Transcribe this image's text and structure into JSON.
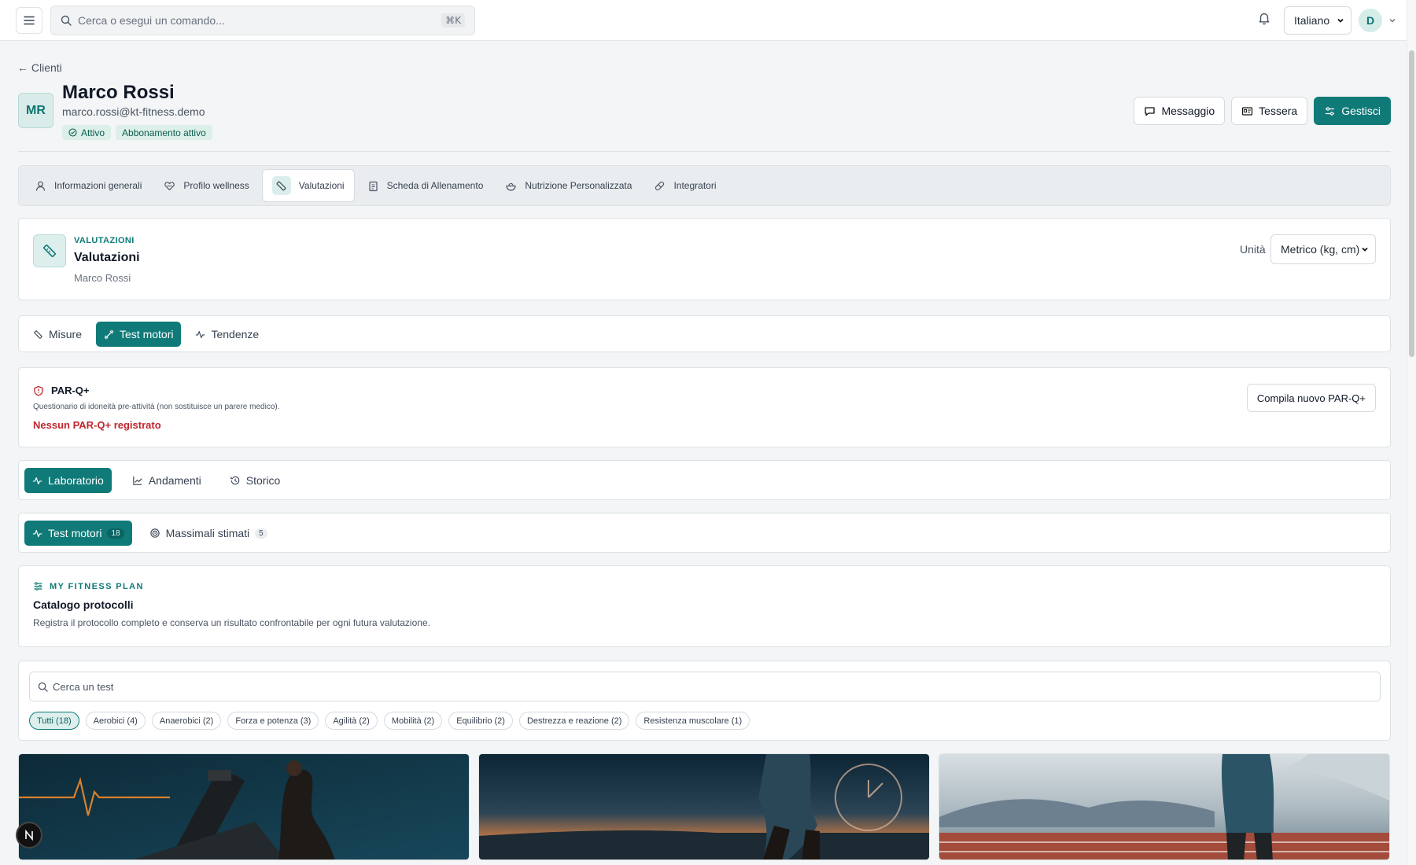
{
  "topbar": {
    "search_placeholder": "Cerca o esegui un comando...",
    "shortcut": "⌘K",
    "language": "Italiano",
    "user_initial": "D"
  },
  "client": {
    "back_label": "← Clienti",
    "initials": "MR",
    "name": "Marco Rossi",
    "email": "marco.rossi@kt-fitness.demo",
    "badges": [
      "Attivo",
      "Abbonamento attivo"
    ]
  },
  "actions": {
    "message": "Messaggio",
    "card": "Tessera",
    "manage": "Gestisci"
  },
  "section_tabs": [
    {
      "label": "Informazioni generali",
      "icon": "user-icon"
    },
    {
      "label": "Profilo wellness",
      "icon": "heart-icon"
    },
    {
      "label": "Valutazioni",
      "icon": "ruler-icon"
    },
    {
      "label": "Scheda di Allenamento",
      "icon": "clipboard-icon"
    },
    {
      "label": "Nutrizione Personalizzata",
      "icon": "salad-icon"
    },
    {
      "label": "Integratori",
      "icon": "pill-icon"
    }
  ],
  "valutazioni": {
    "eyebrow": "VALUTAZIONI",
    "title": "Valutazioni",
    "subtitle": "Marco Rossi",
    "unit_label": "Unità",
    "unit_value": "Metrico (kg, cm)"
  },
  "sub_tabs": [
    "Misure",
    "Test motori",
    "Tendenze"
  ],
  "parq": {
    "title": "PAR-Q+",
    "description": "Questionario di idoneità pre-attività (non sostituisce un parere medico).",
    "status": "Nessun PAR-Q+ registrato",
    "button": "Compila nuovo PAR-Q+"
  },
  "lab_tabs": [
    "Laboratorio",
    "Andamenti",
    "Storico"
  ],
  "test_tabs": [
    {
      "label": "Test motori",
      "count": "18"
    },
    {
      "label": "Massimali stimati",
      "count": "5"
    }
  ],
  "catalog": {
    "eyebrow": "MY FITNESS PLAN",
    "title": "Catalogo protocolli",
    "description": "Registra il protocollo completo e conserva un risultato confrontabile per ogni futura valutazione."
  },
  "test_search_placeholder": "Cerca un test",
  "filters": [
    "Tutti (18)",
    "Aerobici (4)",
    "Anaerobici (2)",
    "Forza e potenza (3)",
    "Agilità (2)",
    "Mobilità (2)",
    "Equilibrio (2)",
    "Destrezza e reazione (2)",
    "Resistenza muscolare (1)"
  ],
  "colors": {
    "accent": "#0f7a78",
    "danger": "#c0262d"
  }
}
